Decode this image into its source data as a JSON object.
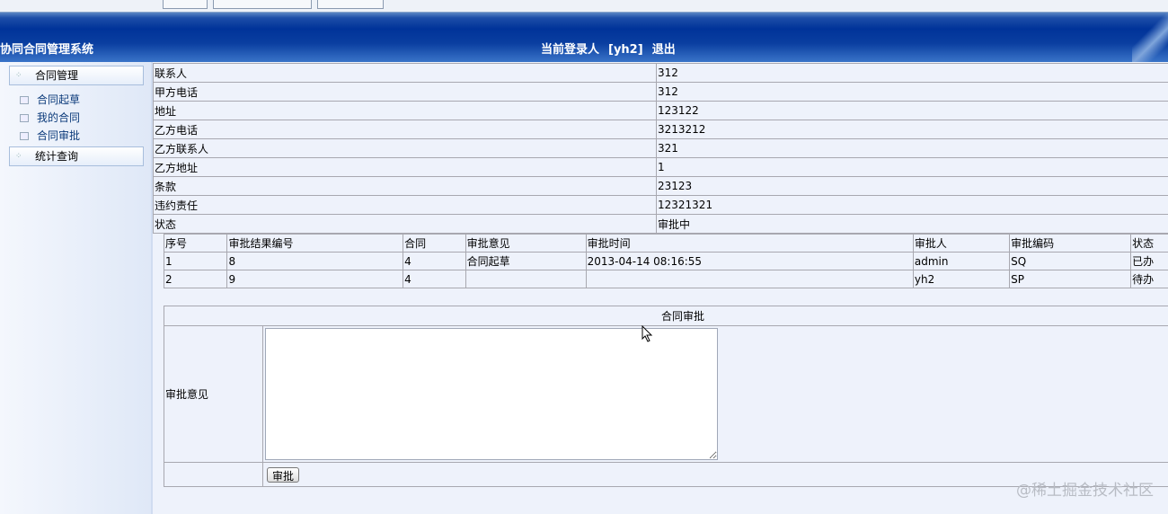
{
  "header": {
    "title": "协同合同管理系统",
    "user_label": "当前登录人",
    "user": "[yh2]",
    "logout": "退出"
  },
  "sidebar": {
    "groups": [
      {
        "label": "合同管理"
      },
      {
        "label": "统计查询"
      }
    ],
    "items": [
      {
        "label": "合同起草"
      },
      {
        "label": "我的合同"
      },
      {
        "label": "合同审批"
      }
    ]
  },
  "info": [
    {
      "label": "联系人",
      "value": "312"
    },
    {
      "label": "甲方电话",
      "value": "312"
    },
    {
      "label": "地址",
      "value": "123122"
    },
    {
      "label": "乙方电话",
      "value": "3213212"
    },
    {
      "label": "乙方联系人",
      "value": "321"
    },
    {
      "label": "乙方地址",
      "value": "1"
    },
    {
      "label": "条款",
      "value": "23123"
    },
    {
      "label": "违约责任",
      "value": "12321321"
    },
    {
      "label": "状态",
      "value": "审批中"
    }
  ],
  "approvals": {
    "headers": [
      "序号",
      "审批结果编号",
      "合同",
      "审批意见",
      "审批时间",
      "审批人",
      "审批编码",
      "状态"
    ],
    "rows": [
      [
        "1",
        "8",
        "4",
        "合同起草",
        "2013-04-14 08:16:55",
        "admin",
        "SQ",
        "已办"
      ],
      [
        "2",
        "9",
        "4",
        "",
        "",
        "yh2",
        "SP",
        "待办"
      ]
    ]
  },
  "form": {
    "title": "合同审批",
    "opinion_label": "审批意见",
    "opinion_value": "",
    "submit": "审批"
  },
  "watermark": "@稀土掘金技术社区"
}
